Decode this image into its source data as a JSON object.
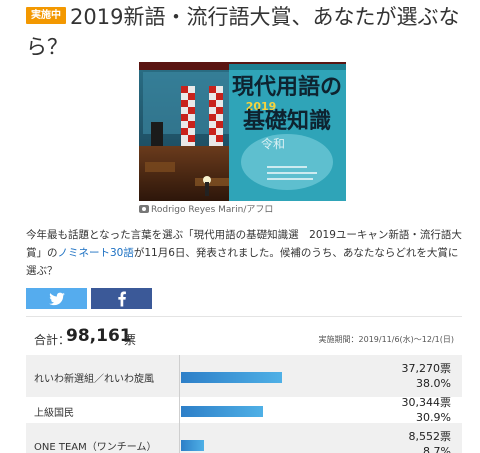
{
  "header": {
    "badge": "実施中",
    "title": "2019新語・流行語大賞、あなたが選ぶなら？"
  },
  "photo": {
    "credit": "Rodrigo Reyes Marin/アフロ",
    "poster_title": "現代用語の基礎知識",
    "poster_year": "2019"
  },
  "description": {
    "before": "今年最も話題となった言葉を選ぶ「現代用語の基礎知識選　2019ユーキャン新語・流行語大賞」の",
    "link": "ノミネート30語",
    "after": "が11月6日、発表されました。候補のうち、あなたならどれを大賞に選ぶ？"
  },
  "share": {
    "twitter_icon": "twitter-bird-icon",
    "facebook_icon": "facebook-f-icon",
    "twitter_color": "#55acee",
    "facebook_color": "#3b5998"
  },
  "totals": {
    "label": "合計：",
    "count": "98,161",
    "unit": "票",
    "period": "実施期間：2019/11/6(水)〜12/1(日)"
  },
  "results": [
    {
      "label": "れいわ新選組／れいわ旋風",
      "votes": "37,270票",
      "pct": "38.0%",
      "share": 0.38
    },
    {
      "label": "上級国民",
      "votes": "30,344票",
      "pct": "30.9%",
      "share": 0.309
    },
    {
      "label": "ONE TEAM（ワンチーム）",
      "votes": "8,552票",
      "pct": "8.7%",
      "share": 0.087
    }
  ]
}
